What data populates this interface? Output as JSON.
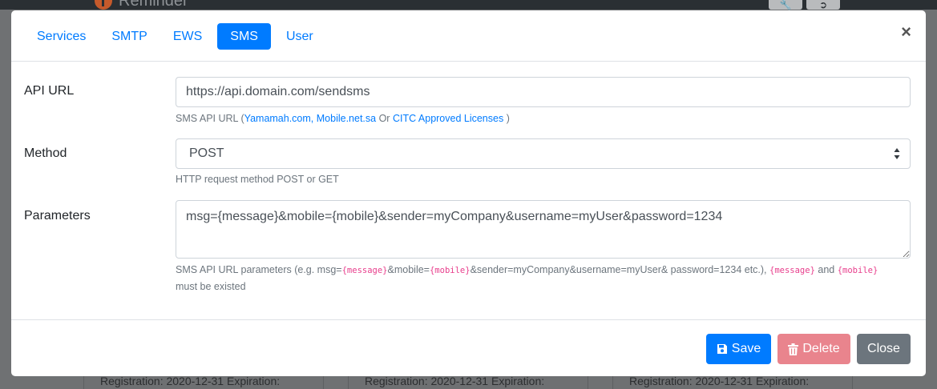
{
  "background": {
    "app_title": "Reminder",
    "cards": [
      {
        "text": "Registration: 2020-12-31 Expiration:"
      },
      {
        "text": "Registration: 2020-12-31 Expiration:"
      },
      {
        "text": "Registration: 2020-12-31 Expiration:"
      }
    ]
  },
  "modal": {
    "tabs": [
      {
        "label": "Services"
      },
      {
        "label": "SMTP"
      },
      {
        "label": "EWS"
      },
      {
        "label": "SMS",
        "active": true
      },
      {
        "label": "User"
      }
    ],
    "close_symbol": "×",
    "api_url": {
      "label": "API URL",
      "value": "https://api.domain.com/sendsms",
      "help_prefix": "SMS API URL (",
      "help_link1": "Yamamah.com, Mobile.net.sa",
      "help_mid": " Or ",
      "help_link2": "CITC Approved Licenses",
      "help_suffix": " )"
    },
    "method": {
      "label": "Method",
      "value": "POST",
      "help": "HTTP request method POST or GET"
    },
    "parameters": {
      "label": "Parameters",
      "value": "msg={message}&mobile={mobile}&sender=myCompany&username=myUser&password=1234",
      "help_1": "SMS API URL parameters (e.g. msg=",
      "help_code1": "{message}",
      "help_2": "&mobile=",
      "help_code2": "{mobile}",
      "help_3": "&sender=myCompany&username=myUser& password=1234 etc.), ",
      "help_code3": "{message}",
      "help_4": " and ",
      "help_code4": "{mobile}",
      "help_5": " must be existed"
    },
    "footer": {
      "save_label": "Save",
      "delete_label": "Delete",
      "close_label": "Close"
    }
  },
  "colors": {
    "primary": "#007bff",
    "danger_disabled": "#e9848d",
    "secondary": "#6c757d",
    "code": "#e83e8c"
  }
}
